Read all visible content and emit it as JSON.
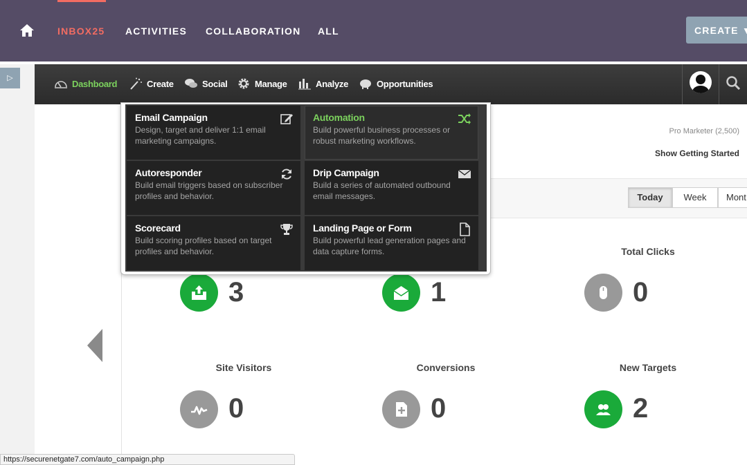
{
  "topnav": {
    "items": [
      {
        "label": "INBOX25",
        "active": true
      },
      {
        "label": "ACTIVITIES"
      },
      {
        "label": "COLLABORATION"
      },
      {
        "label": "ALL"
      }
    ],
    "create_label": "CREATE ▼",
    "active_color": "#f26c62",
    "bar_color": "#554c66"
  },
  "rail_toggle": "▷",
  "subnav": {
    "items": [
      {
        "label": "Dashboard",
        "icon": "speedometer-icon",
        "active": true
      },
      {
        "label": "Create",
        "icon": "magic-wand-icon"
      },
      {
        "label": "Social",
        "icon": "speech-bubbles-icon"
      },
      {
        "label": "Manage",
        "icon": "gear-icon"
      },
      {
        "label": "Analyze",
        "icon": "bar-chart-icon"
      },
      {
        "label": "Opportunities",
        "icon": "piggy-bank-icon"
      }
    ],
    "active_color": "#7bd15d"
  },
  "create_menu": {
    "tiles": [
      {
        "title": "Email Campaign",
        "desc": "Design, target and deliver 1:1 email marketing campaigns.",
        "icon": "edit-icon"
      },
      {
        "title": "Automation",
        "desc": "Build powerful business processes or robust marketing workflows.",
        "icon": "shuffle-icon",
        "highlight": true
      },
      {
        "title": "Autoresponder",
        "desc": "Build email triggers based on subscriber profiles and behavior.",
        "icon": "refresh-icon"
      },
      {
        "title": "Drip Campaign",
        "desc": "Build a series of automated outbound email messages.",
        "icon": "envelope-icon"
      },
      {
        "title": "Scorecard",
        "desc": "Build scoring profiles based on target profiles and behavior.",
        "icon": "trophy-icon"
      },
      {
        "title": "Landing Page or Form",
        "desc": "Build powerful lead generation pages and data capture forms.",
        "icon": "page-icon"
      }
    ]
  },
  "account": {
    "plan": "Pro Marketer (2,500)",
    "getting_started": "Show Getting Started"
  },
  "ranges": [
    "Today",
    "Week",
    "Mont"
  ],
  "stats": [
    {
      "label": "",
      "value": "3",
      "icon": "inbox-upload-icon",
      "color": "green"
    },
    {
      "label": "",
      "value": "1",
      "icon": "open-envelope-icon",
      "color": "green"
    },
    {
      "label": "Total Clicks",
      "value": "0",
      "icon": "mouse-icon",
      "color": "gray"
    },
    {
      "label": "Site Visitors",
      "value": "0",
      "icon": "activity-icon",
      "color": "gray"
    },
    {
      "label": "Conversions",
      "value": "0",
      "icon": "add-document-icon",
      "color": "gray"
    },
    {
      "label": "New Targets",
      "value": "2",
      "icon": "users-icon",
      "color": "green"
    }
  ],
  "status_url": "https://securenetgate7.com/auto_campaign.php"
}
